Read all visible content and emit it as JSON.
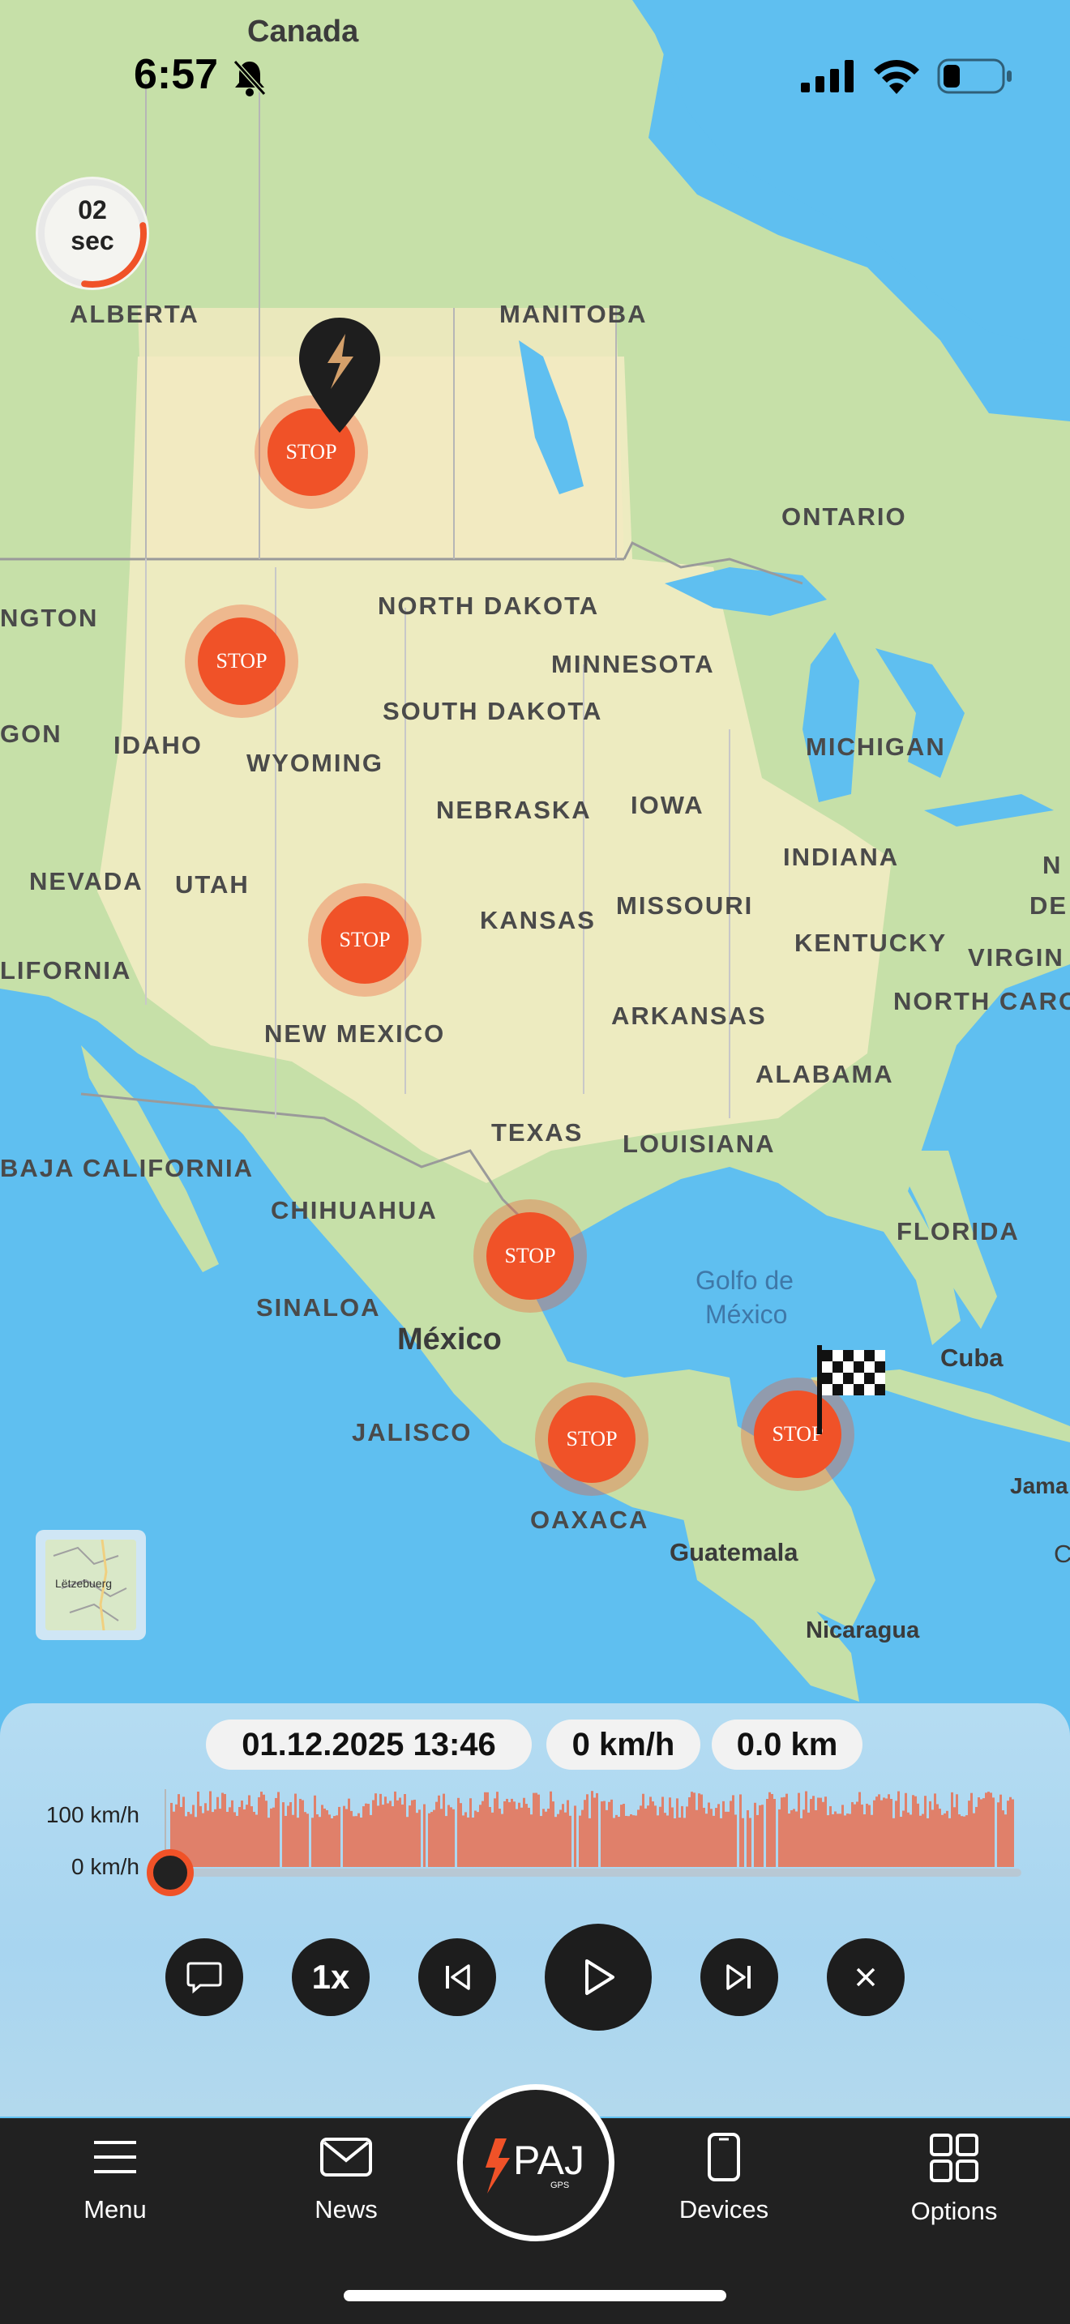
{
  "status_bar": {
    "time": "6:57",
    "icons": [
      "bell-slash-icon",
      "signal-icon",
      "wifi-icon",
      "battery-icon"
    ]
  },
  "timer": {
    "value": "02",
    "unit": "sec",
    "progress": 0.3
  },
  "map": {
    "labels": [
      {
        "text": "Canada",
        "kind": "country"
      },
      {
        "text": "ALBERTA",
        "kind": "region"
      },
      {
        "text": "MANITOBA",
        "kind": "region"
      },
      {
        "text": "ONTARIO",
        "kind": "region"
      },
      {
        "text": "NGTON",
        "kind": "region"
      },
      {
        "text": "NORTH DAKOTA",
        "kind": "region"
      },
      {
        "text": "MINNESOTA",
        "kind": "region"
      },
      {
        "text": "GON",
        "kind": "region"
      },
      {
        "text": "IDAHO",
        "kind": "region"
      },
      {
        "text": "SOUTH DAKOTA",
        "kind": "region"
      },
      {
        "text": "WYOMING",
        "kind": "region"
      },
      {
        "text": "MICHIGAN",
        "kind": "region"
      },
      {
        "text": "NEBRASKA",
        "kind": "region"
      },
      {
        "text": "IOWA",
        "kind": "region"
      },
      {
        "text": "NEVADA",
        "kind": "region"
      },
      {
        "text": "UTAH",
        "kind": "region"
      },
      {
        "text": "INDIANA",
        "kind": "region"
      },
      {
        "text": "N",
        "kind": "region"
      },
      {
        "text": "DE",
        "kind": "region"
      },
      {
        "text": "MISSOURI",
        "kind": "region"
      },
      {
        "text": "KANSAS",
        "kind": "region"
      },
      {
        "text": "KENTUCKY",
        "kind": "region"
      },
      {
        "text": "VIRGIN",
        "kind": "region"
      },
      {
        "text": "LIFORNIA",
        "kind": "region"
      },
      {
        "text": "NORTH CARO",
        "kind": "region"
      },
      {
        "text": "ARKANSAS",
        "kind": "region"
      },
      {
        "text": "NEW MEXICO",
        "kind": "region"
      },
      {
        "text": "ALABAMA",
        "kind": "region"
      },
      {
        "text": "TEXAS",
        "kind": "region"
      },
      {
        "text": "LOUISIANA",
        "kind": "region"
      },
      {
        "text": "BAJA CALIFORNIA",
        "kind": "region"
      },
      {
        "text": "CHIHUAHUA",
        "kind": "region"
      },
      {
        "text": "FLORIDA",
        "kind": "region"
      },
      {
        "text": "Golfo de",
        "kind": "water"
      },
      {
        "text": "México",
        "kind": "water"
      },
      {
        "text": "SINALOA",
        "kind": "region"
      },
      {
        "text": "México",
        "kind": "country"
      },
      {
        "text": "Cuba",
        "kind": "city"
      },
      {
        "text": "JALISCO",
        "kind": "region"
      },
      {
        "text": "OAXACA",
        "kind": "region"
      },
      {
        "text": "Jama",
        "kind": "city"
      },
      {
        "text": "C",
        "kind": "city"
      },
      {
        "text": "Guatemala",
        "kind": "city"
      },
      {
        "text": "Nicaragua",
        "kind": "city"
      }
    ],
    "stops": [
      {
        "label": "STOP"
      },
      {
        "label": "STOP"
      },
      {
        "label": "STOP"
      },
      {
        "label": "STOP"
      },
      {
        "label": "STOP"
      },
      {
        "label": "STOP"
      }
    ],
    "mini_map_label": "Lëtzebuerg"
  },
  "playback": {
    "datetime": "01.12.2025 13:46",
    "speed": "0 km/h",
    "distance": "0.0 km",
    "y_max_label": "100 km/h",
    "y_min_label": "0 km/h",
    "progress": 0.0,
    "speed_multiplier": "1x",
    "colors": {
      "graph": "#e0806a",
      "accent": "#f05228"
    }
  },
  "nav": {
    "menu": "Menu",
    "news": "News",
    "logo": "PAJ",
    "logo_sub": "GPS",
    "devices": "Devices",
    "options": "Options"
  }
}
